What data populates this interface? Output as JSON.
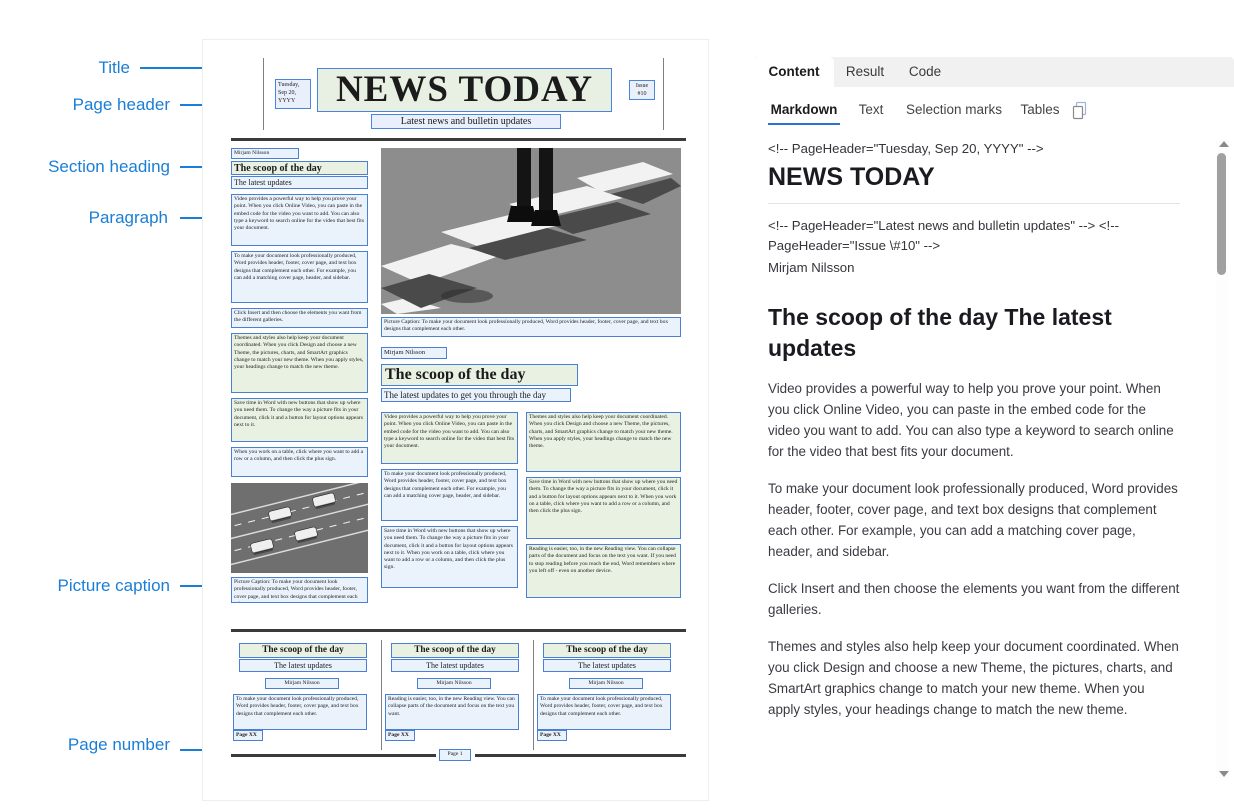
{
  "annotations": [
    {
      "id": "title",
      "label": "Title"
    },
    {
      "id": "page-header",
      "label": "Page header"
    },
    {
      "id": "section-heading",
      "label": "Section heading"
    },
    {
      "id": "paragraph",
      "label": "Paragraph"
    },
    {
      "id": "picture-caption",
      "label": "Picture caption"
    },
    {
      "id": "page-number",
      "label": "Page number"
    }
  ],
  "document": {
    "masthead": {
      "date": "Tuesday, Sep 20, YYYY",
      "title": "NEWS TODAY",
      "issue": "Issue #10",
      "subtitle": "Latest news and bulletin updates"
    },
    "section1": {
      "author": "Mirjam Nilsson",
      "heading": "The scoop of the day",
      "subheading": "The latest updates",
      "paragraphs": [
        "Video provides a powerful way to help you prove your point. When you click Online Video, you can paste in the embed code for the video you want to add. You can also type a keyword to search online for the video that best fits your document.",
        "To make your document look professionally produced, Word provides header, footer, cover page, and text box designs that complement each other. For example, you can add a matching cover page, header, and sidebar.",
        "Click Insert and then choose the elements you want from the different galleries.",
        "Themes and styles also help keep your document coordinated. When you click Design and choose a new Theme, the pictures, charts, and SmartArt graphics change to match your new theme. When you apply styles, your headings change to match the new theme.",
        "Save time in Word with new buttons that show up where you need them. To change the way a picture fits in your document, click it and a button for layout options appears next to it.",
        "When you work on a table, click where you want to add a row or a column, and then click the plus sign."
      ],
      "picture_caption": "Picture Caption: To make your document look professionally produced, Word provides header, footer, cover page, and text box designs that complement each other."
    },
    "section2": {
      "author": "Mirjam Nilsson",
      "heading": "The scoop of the day",
      "subheading": "The latest updates to get you through the day",
      "left_paragraphs": [
        "Video provides a powerful way to help you prove your point. When you click Online Video, you can paste in the embed code for the video you want to add. You can also type a keyword to search online for the video that best fits your document.",
        "To make your document look professionally produced, Word provides header, footer, cover page, and text box designs that complement each other. For example, you can add a matching cover page, header, and sidebar.",
        "Save time in Word with new buttons that show up where you need them. To change the way a picture fits in your document, click it and a button for layout options appears next to it. When you work on a table, click where you want to add a row or a column, and then click the plus sign."
      ],
      "right_paragraphs": [
        "Themes and styles also help keep your document coordinated. When you click Design and choose a new Theme, the pictures, charts, and SmartArt graphics change to match your new theme. When you apply styles, your headings change to match the new theme.",
        "Save time in Word with new buttons that show up where you need them. To change the way a picture fits in your document, click it and a button for layout options appears next to it. When you work on a table, click where you want to add a row or a column, and then click the plus sign.",
        "Reading is easier, too, in the new Reading view. You can collapse parts of the document and focus on the text you want. If you need to stop reading before you reach the end, Word remembers where you left off - even on another device."
      ],
      "picture_caption": "Picture Caption: To make your document look professionally produced, Word provides header, footer, cover page, and text box designs that complement each other."
    },
    "columns": [
      {
        "heading": "The scoop of the day",
        "subheading": "The latest updates",
        "author": "Mirjam Nilsson",
        "body": "To make your document look professionally produced, Word provides header, footer, cover page, and text box designs that complement each other.",
        "page": "Page XX"
      },
      {
        "heading": "The scoop of the day",
        "subheading": "The latest updates",
        "author": "Mirjam Nilsson",
        "body": "Reading is easier, too, in the new Reading view. You can collapse parts of the document and focus on the text you want.",
        "page": "Page XX"
      },
      {
        "heading": "The scoop of the day",
        "subheading": "The latest updates",
        "author": "Mirjam Nilsson",
        "body": "To make your document look professionally produced, Word provides header, footer, cover page, and text box designs that complement each other.",
        "page": "Page XX"
      }
    ],
    "page_number": "Page 1"
  },
  "panel": {
    "tabs": [
      {
        "label": "Content",
        "active": true
      },
      {
        "label": "Result",
        "active": false
      },
      {
        "label": "Code",
        "active": false
      }
    ],
    "subtabs": [
      {
        "label": "Markdown",
        "active": true
      },
      {
        "label": "Text",
        "active": false
      },
      {
        "label": "Selection marks",
        "active": false
      },
      {
        "label": "Tables",
        "active": false
      }
    ],
    "copy_icon": "copy-icon",
    "markdown": {
      "comment1": "<!-- PageHeader=\"Tuesday, Sep 20, YYYY\" -->",
      "h1": "NEWS TODAY",
      "comment2": "<!-- PageHeader=\"Latest news and bulletin updates\" --> <!-- PageHeader=\"Issue \\#10\" -->",
      "author": "Mirjam Nilsson",
      "h2": "The scoop of the day The latest updates",
      "p1": "Video provides a powerful way to help you prove your point. When you click Online Video, you can paste in the embed code for the video you want to add. You can also type a keyword to search online for the video that best fits your document.",
      "p2": "To make your document look professionally produced, Word provides header, footer, cover page, and text box designs that complement each other. For example, you can add a matching cover page, header, and sidebar.",
      "p3": "Click Insert and then choose the elements you want from the different galleries.",
      "p4": "Themes and styles also help keep your document coordinated. When you click Design and choose a new Theme, the pictures, charts, and SmartArt graphics change to match your new theme. When you apply styles, your headings change to match the new theme."
    }
  },
  "colors": {
    "accent_blue": "#1a7ed6",
    "box_border": "#4a7fd4",
    "box_fill": "#eaf2fc",
    "tab_underline": "#2f6fd0"
  }
}
